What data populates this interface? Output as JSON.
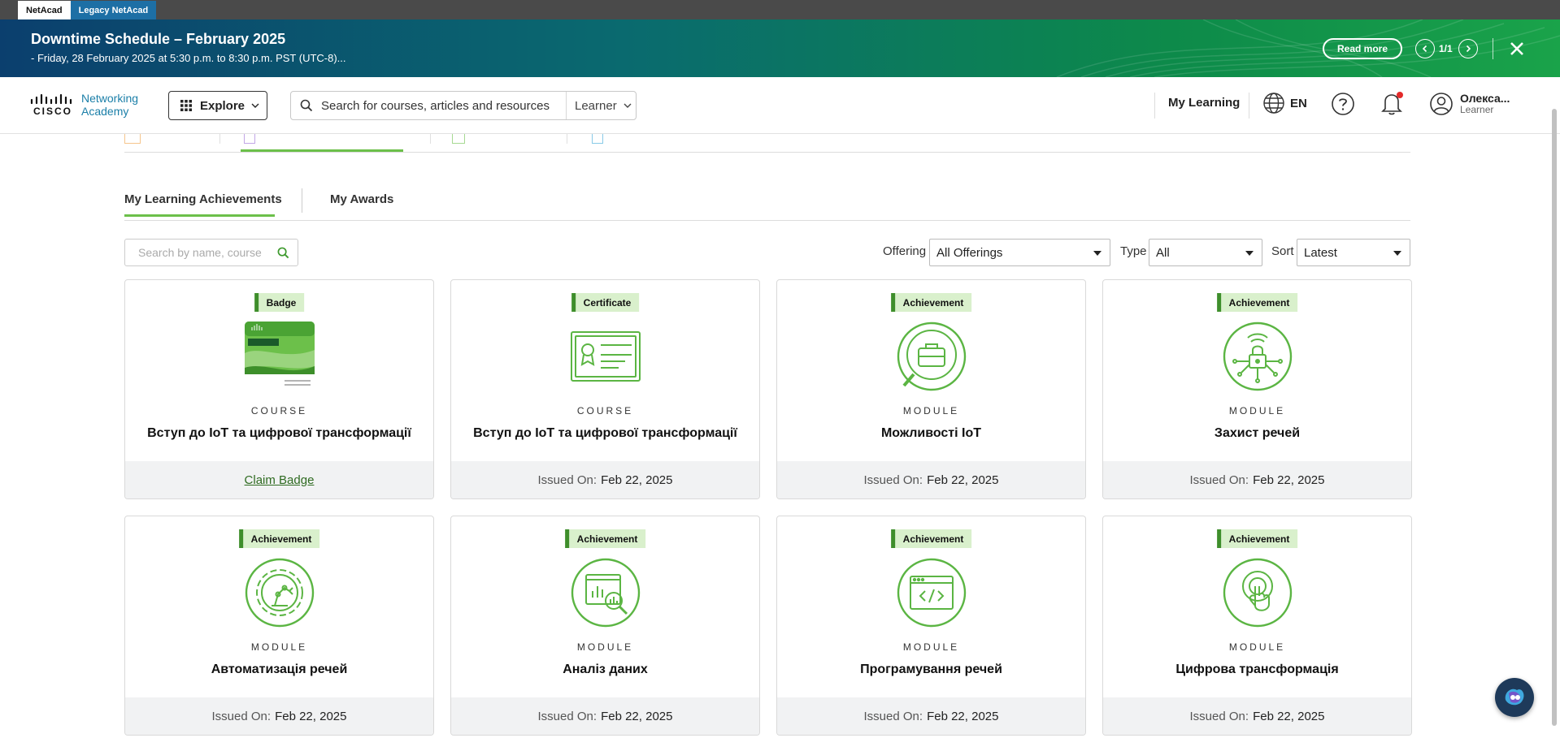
{
  "top_strip": {
    "tabs": [
      "NetAcad",
      "Legacy NetAcad"
    ]
  },
  "banner": {
    "title": "Downtime Schedule – February 2025",
    "subtitle": "- Friday, 28 February 2025 at 5:30 p.m. to 8:30 p.m. PST (UTC-8)...",
    "read_more": "Read more",
    "pager": "1/1"
  },
  "header": {
    "logo_word": "CISCO",
    "logo_line1": "Networking",
    "logo_line2": "Academy",
    "explore": "Explore",
    "search_placeholder": "Search for courses, articles and resources",
    "role_select": "Learner",
    "my_learning": "My Learning",
    "lang": "EN",
    "user_name": "Олекса...",
    "user_role": "Learner"
  },
  "subtabs": [
    "My Learning Achievements",
    "My Awards"
  ],
  "filters": {
    "search_placeholder": "Search by name, course",
    "offering_label": "Offering",
    "offering_value": "All Offerings",
    "type_label": "Type",
    "type_value": "All",
    "sort_label": "Sort",
    "sort_value": "Latest"
  },
  "cards": [
    {
      "tag": "Badge",
      "kind": "COURSE",
      "title": "Вступ до IoT та цифрової трансформації",
      "action": "Claim Badge",
      "icon": "iot-badge-image"
    },
    {
      "tag": "Certificate",
      "kind": "COURSE",
      "title": "Вступ до IoT та цифрової трансформації",
      "issued_label": "Issued On:",
      "issued": "Feb 22, 2025",
      "icon": "certificate-icon"
    },
    {
      "tag": "Achievement",
      "kind": "MODULE",
      "title": "Можливості IoT",
      "issued_label": "Issued On:",
      "issued": "Feb 22, 2025",
      "icon": "briefcase-magnifier-icon"
    },
    {
      "tag": "Achievement",
      "kind": "MODULE",
      "title": "Захист речей",
      "issued_label": "Issued On:",
      "issued": "Feb 22, 2025",
      "icon": "lock-network-icon"
    },
    {
      "tag": "Achievement",
      "kind": "MODULE",
      "title": "Автоматизація речей",
      "issued_label": "Issued On:",
      "issued": "Feb 22, 2025",
      "icon": "robot-arm-gear-icon"
    },
    {
      "tag": "Achievement",
      "kind": "MODULE",
      "title": "Аналіз даних",
      "issued_label": "Issued On:",
      "issued": "Feb 22, 2025",
      "icon": "data-analysis-icon"
    },
    {
      "tag": "Achievement",
      "kind": "MODULE",
      "title": "Програмування речей",
      "issued_label": "Issued On:",
      "issued": "Feb 22, 2025",
      "icon": "code-window-icon"
    },
    {
      "tag": "Achievement",
      "kind": "MODULE",
      "title": "Цифрова трансформація",
      "issued_label": "Issued On:",
      "issued": "Feb 22, 2025",
      "icon": "touch-finger-icon"
    }
  ],
  "colors": {
    "accent_green": "#6cc04a",
    "tag_bg": "#d9f0cc",
    "tag_border": "#3e8e2b",
    "icon_green": "#5bb543"
  }
}
